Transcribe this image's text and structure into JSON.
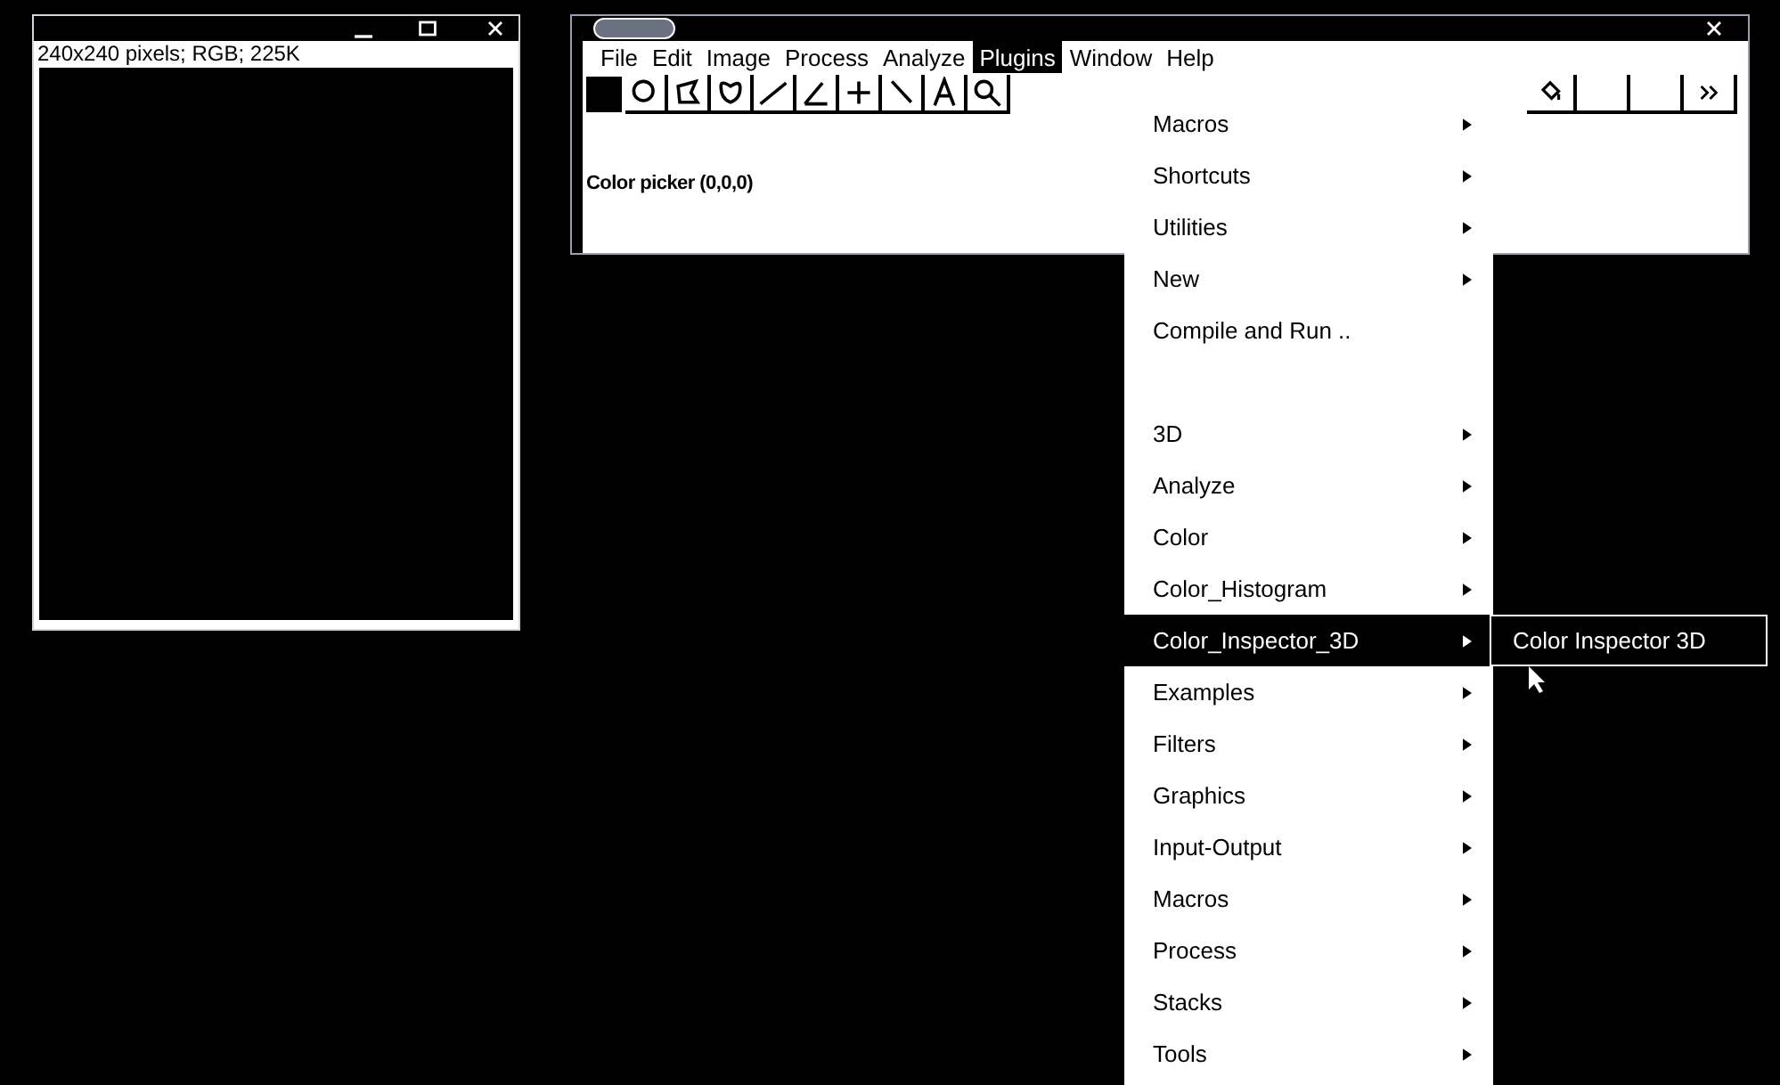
{
  "image_window": {
    "info": "240x240 pixels; RGB; 225K"
  },
  "main_window": {
    "menu_bar": [
      {
        "label": "File",
        "selected": false
      },
      {
        "label": "Edit",
        "selected": false
      },
      {
        "label": "Image",
        "selected": false
      },
      {
        "label": "Process",
        "selected": false
      },
      {
        "label": "Analyze",
        "selected": false
      },
      {
        "label": "Plugins",
        "selected": true
      },
      {
        "label": "Window",
        "selected": false
      },
      {
        "label": "Help",
        "selected": false
      }
    ],
    "status": "Color picker (0,0,0)"
  },
  "plugins_menu": [
    {
      "kind": "submenu",
      "label": "Macros",
      "selected": false
    },
    {
      "kind": "submenu",
      "label": "Shortcuts",
      "selected": false
    },
    {
      "kind": "submenu",
      "label": "Utilities",
      "selected": false
    },
    {
      "kind": "submenu",
      "label": "New",
      "selected": false
    },
    {
      "kind": "action",
      "label": "Compile and Run ..",
      "selected": false
    },
    {
      "kind": "separator"
    },
    {
      "kind": "submenu",
      "label": "3D",
      "selected": false
    },
    {
      "kind": "submenu",
      "label": "Analyze",
      "selected": false
    },
    {
      "kind": "submenu",
      "label": "Color",
      "selected": false
    },
    {
      "kind": "submenu",
      "label": "Color_Histogram",
      "selected": false
    },
    {
      "kind": "submenu",
      "label": "Color_Inspector_3D",
      "selected": true
    },
    {
      "kind": "submenu",
      "label": "Examples",
      "selected": false
    },
    {
      "kind": "submenu",
      "label": "Filters",
      "selected": false
    },
    {
      "kind": "submenu",
      "label": "Graphics",
      "selected": false
    },
    {
      "kind": "submenu",
      "label": "Input-Output",
      "selected": false
    },
    {
      "kind": "submenu",
      "label": "Macros",
      "selected": false
    },
    {
      "kind": "submenu",
      "label": "Process",
      "selected": false
    },
    {
      "kind": "submenu",
      "label": "Stacks",
      "selected": false
    },
    {
      "kind": "submenu",
      "label": "Tools",
      "selected": false
    }
  ],
  "submenu": [
    {
      "label": "Color Inspector 3D",
      "selected": false
    }
  ]
}
